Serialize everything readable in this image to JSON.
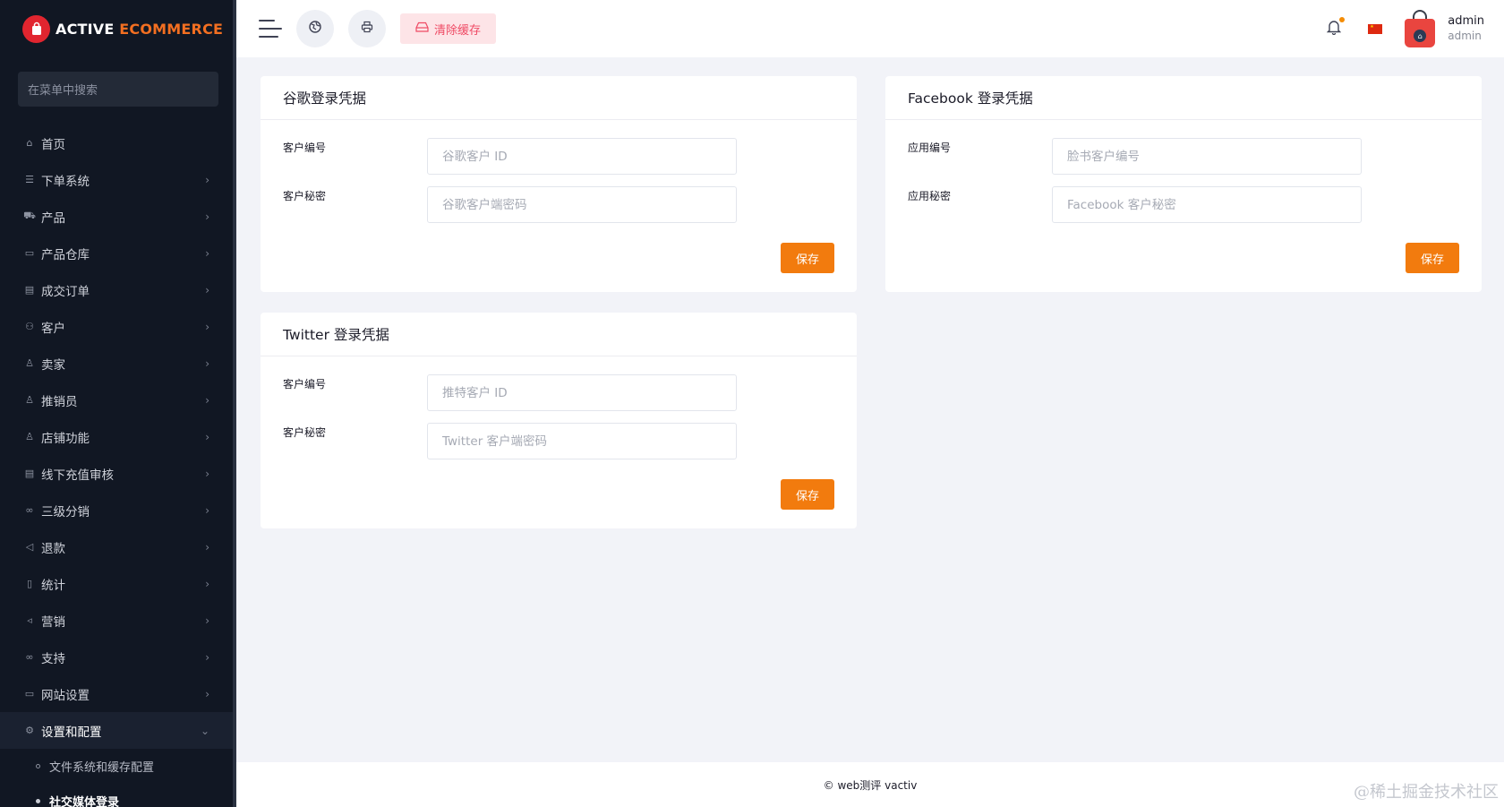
{
  "brand": {
    "name_white": "ACTIVE",
    "name_orange": "ECOMMERCE",
    "logo_icon": "shopping-bag-icon"
  },
  "sidebar": {
    "search_placeholder": "在菜单中搜索",
    "items": [
      {
        "label": "首页",
        "icon": "home-icon",
        "arrow": false
      },
      {
        "label": "下单系统",
        "icon": "list-icon",
        "arrow": true
      },
      {
        "label": "产品",
        "icon": "cart-icon",
        "arrow": true
      },
      {
        "label": "产品仓库",
        "icon": "archive-icon",
        "arrow": true
      },
      {
        "label": "成交订单",
        "icon": "card-icon",
        "arrow": true
      },
      {
        "label": "客户",
        "icon": "users-icon",
        "arrow": true
      },
      {
        "label": "卖家",
        "icon": "user-icon",
        "arrow": true
      },
      {
        "label": "推销员",
        "icon": "user-tie-icon",
        "arrow": true
      },
      {
        "label": "店铺功能",
        "icon": "store-icon",
        "arrow": true
      },
      {
        "label": "线下充值审核",
        "icon": "wallet-icon",
        "arrow": true
      },
      {
        "label": "三级分销",
        "icon": "link-icon",
        "arrow": true
      },
      {
        "label": "退款",
        "icon": "backward-icon",
        "arrow": true
      },
      {
        "label": "统计",
        "icon": "report-icon",
        "arrow": true
      },
      {
        "label": "营销",
        "icon": "bullhorn-icon",
        "arrow": true
      },
      {
        "label": "支持",
        "icon": "support-icon",
        "arrow": true
      },
      {
        "label": "网站设置",
        "icon": "desktop-icon",
        "arrow": true
      },
      {
        "label": "设置和配置",
        "icon": "cog-icon",
        "arrow": "down"
      }
    ],
    "sub_items": [
      {
        "label": "文件系统和缓存配置"
      },
      {
        "label": "社交媒体登录"
      }
    ]
  },
  "topbar": {
    "menu_icon": "hamburger-icon",
    "globe_icon": "globe-icon",
    "print_icon": "printer-icon",
    "clear_cache_label": "清除缓存",
    "notification_icon": "bell-icon",
    "language_flag": "china-flag-icon",
    "user_name": "admin",
    "user_role": "admin"
  },
  "cards": {
    "google": {
      "title": "谷歌登录凭据",
      "client_id_label": "客户编号",
      "client_id_placeholder": "谷歌客户 ID",
      "client_secret_label": "客户秘密",
      "client_secret_placeholder": "谷歌客户端密码",
      "save_label": "保存"
    },
    "facebook": {
      "title": "Facebook 登录凭据",
      "app_id_label": "应用编号",
      "app_id_placeholder": "脸书客户编号",
      "app_secret_label": "应用秘密",
      "app_secret_placeholder": "Facebook 客户秘密",
      "save_label": "保存"
    },
    "twitter": {
      "title": "Twitter 登录凭据",
      "client_id_label": "客户编号",
      "client_id_placeholder": "推特客户 ID",
      "client_secret_label": "客户秘密",
      "client_secret_placeholder": "Twitter 客户端密码",
      "save_label": "保存"
    }
  },
  "footer": {
    "text": "© web测评 vactiv"
  },
  "watermark": "@稀土掘金技术社区",
  "colors": {
    "sidebar_bg": "#111723",
    "accent_orange": "#f27b0e",
    "brand_red": "#e1252f",
    "clear_cache_bg": "#fde4e7",
    "clear_cache_text": "#ef4a64"
  }
}
